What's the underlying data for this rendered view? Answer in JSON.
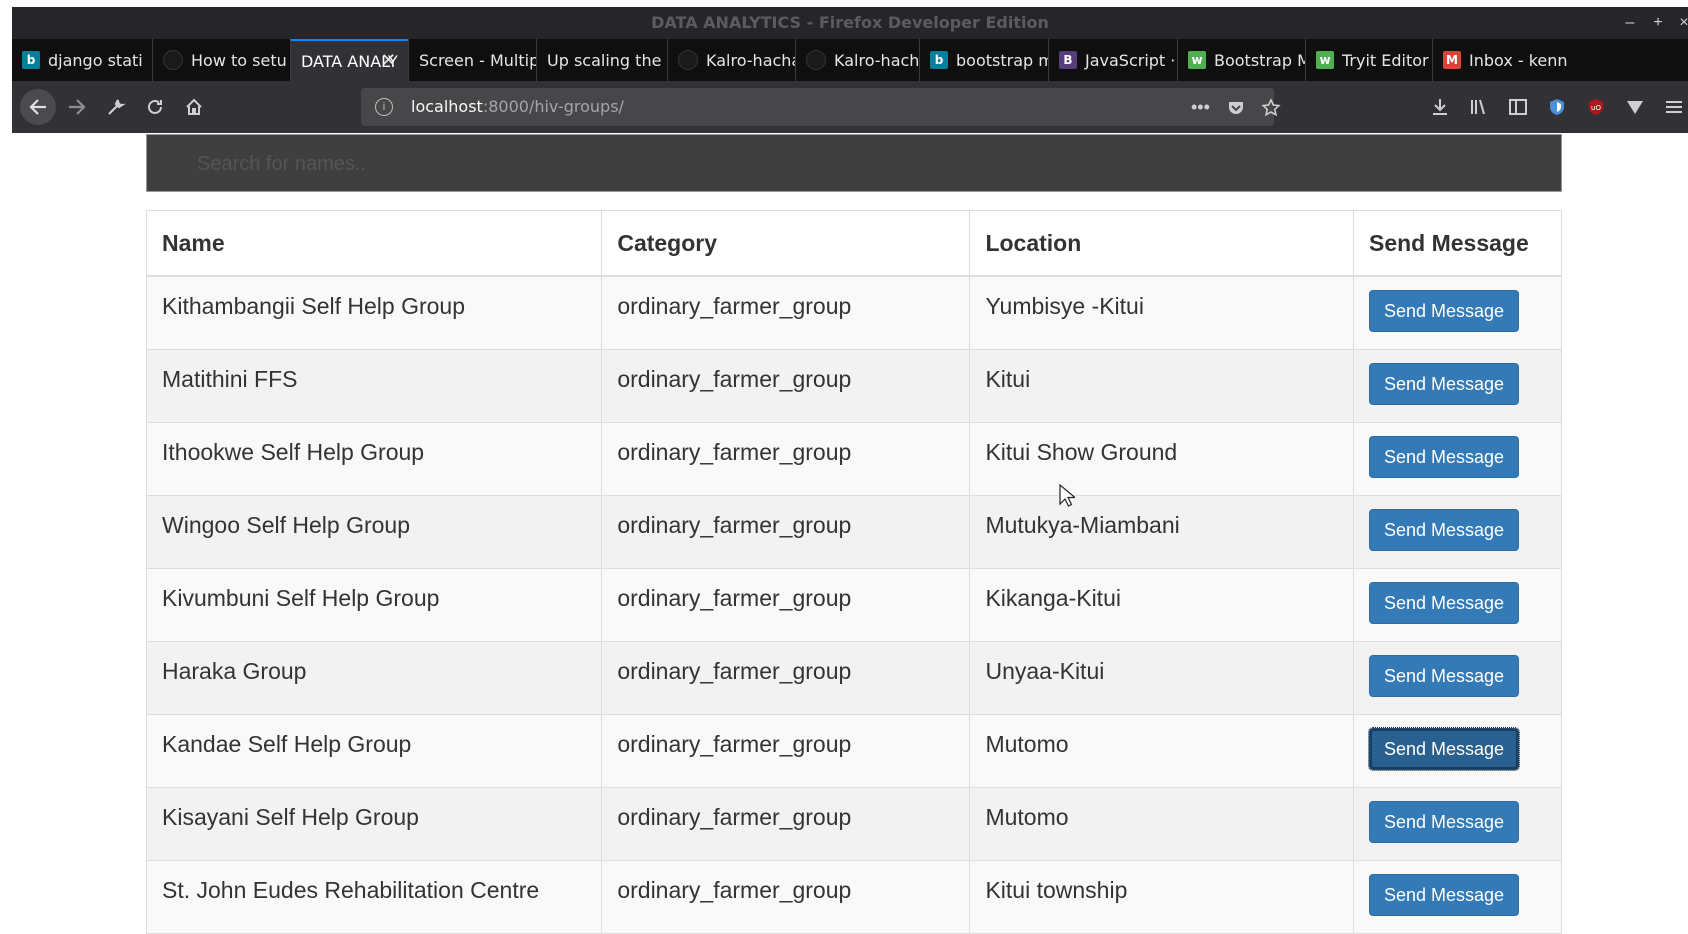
{
  "window": {
    "title": "DATA ANALYTICS - Firefox Developer Edition",
    "controls": {
      "minimize": "–",
      "maximize": "+",
      "close": "×"
    }
  },
  "tabs": [
    {
      "label": "django stati",
      "favicon": "bing",
      "color": "#00809d"
    },
    {
      "label": "How to setu",
      "favicon": "github",
      "color": "#222222"
    },
    {
      "label": "DATA ANALY",
      "favicon": "none",
      "active": true
    },
    {
      "label": "Screen - Multipu",
      "favicon": "none"
    },
    {
      "label": "Up scaling the g",
      "favicon": "none"
    },
    {
      "label": "Kalro-hachat",
      "favicon": "github",
      "color": "#222222"
    },
    {
      "label": "Kalro-hachat",
      "favicon": "github",
      "color": "#222222"
    },
    {
      "label": "bootstrap m",
      "favicon": "bing",
      "color": "#00809d"
    },
    {
      "label": "JavaScript · E",
      "favicon": "bootstrap",
      "color": "#563d7c"
    },
    {
      "label": "Bootstrap M",
      "favicon": "w3schools",
      "color": "#4caf50"
    },
    {
      "label": "Tryit Editor v",
      "favicon": "w3schools",
      "color": "#4caf50"
    },
    {
      "label": "Inbox - kenn",
      "favicon": "gmail",
      "color": "#d44638"
    }
  ],
  "navbar": {
    "url_host": "localhost",
    "url_rest": ":8000/hiv-groups/",
    "icons": [
      "back-icon",
      "forward-icon",
      "wrench-icon",
      "reload-icon",
      "home-icon"
    ],
    "url_icons": [
      "more-icon",
      "pocket-icon",
      "star-icon"
    ],
    "toolbar_icons": [
      "download-icon",
      "library-icon",
      "sidebar-icon",
      "shield-icon",
      "ublock-icon",
      "vimium-icon",
      "menu-icon"
    ]
  },
  "search": {
    "placeholder": "Search for names.."
  },
  "table": {
    "headers": [
      "Name",
      "Category",
      "Location",
      "Send Message"
    ],
    "button_label": "Send Message",
    "rows": [
      {
        "name": "Kithambangii Self Help Group",
        "category": "ordinary_farmer_group",
        "location": "Yumbisye -Kitui"
      },
      {
        "name": "Matithini FFS",
        "category": "ordinary_farmer_group",
        "location": "Kitui"
      },
      {
        "name": "Ithookwe Self Help Group",
        "category": "ordinary_farmer_group",
        "location": "Kitui Show Ground"
      },
      {
        "name": "Wingoo Self Help Group",
        "category": "ordinary_farmer_group",
        "location": "Mutukya-Miambani"
      },
      {
        "name": "Kivumbuni Self Help Group",
        "category": "ordinary_farmer_group",
        "location": "Kikanga-Kitui"
      },
      {
        "name": "Haraka Group",
        "category": "ordinary_farmer_group",
        "location": "Unyaa-Kitui"
      },
      {
        "name": "Kandae Self Help Group",
        "category": "ordinary_farmer_group",
        "location": "Mutomo",
        "focused": true
      },
      {
        "name": "Kisayani Self Help Group",
        "category": "ordinary_farmer_group",
        "location": "Mutomo"
      },
      {
        "name": "St. John Eudes Rehabilitation Centre",
        "category": "ordinary_farmer_group",
        "location": "Kitui township"
      }
    ]
  },
  "colors": {
    "primary_button": "#337ab7",
    "browser_chrome": "#2a2a2e",
    "tab_active_accent": "#0a84ff"
  }
}
